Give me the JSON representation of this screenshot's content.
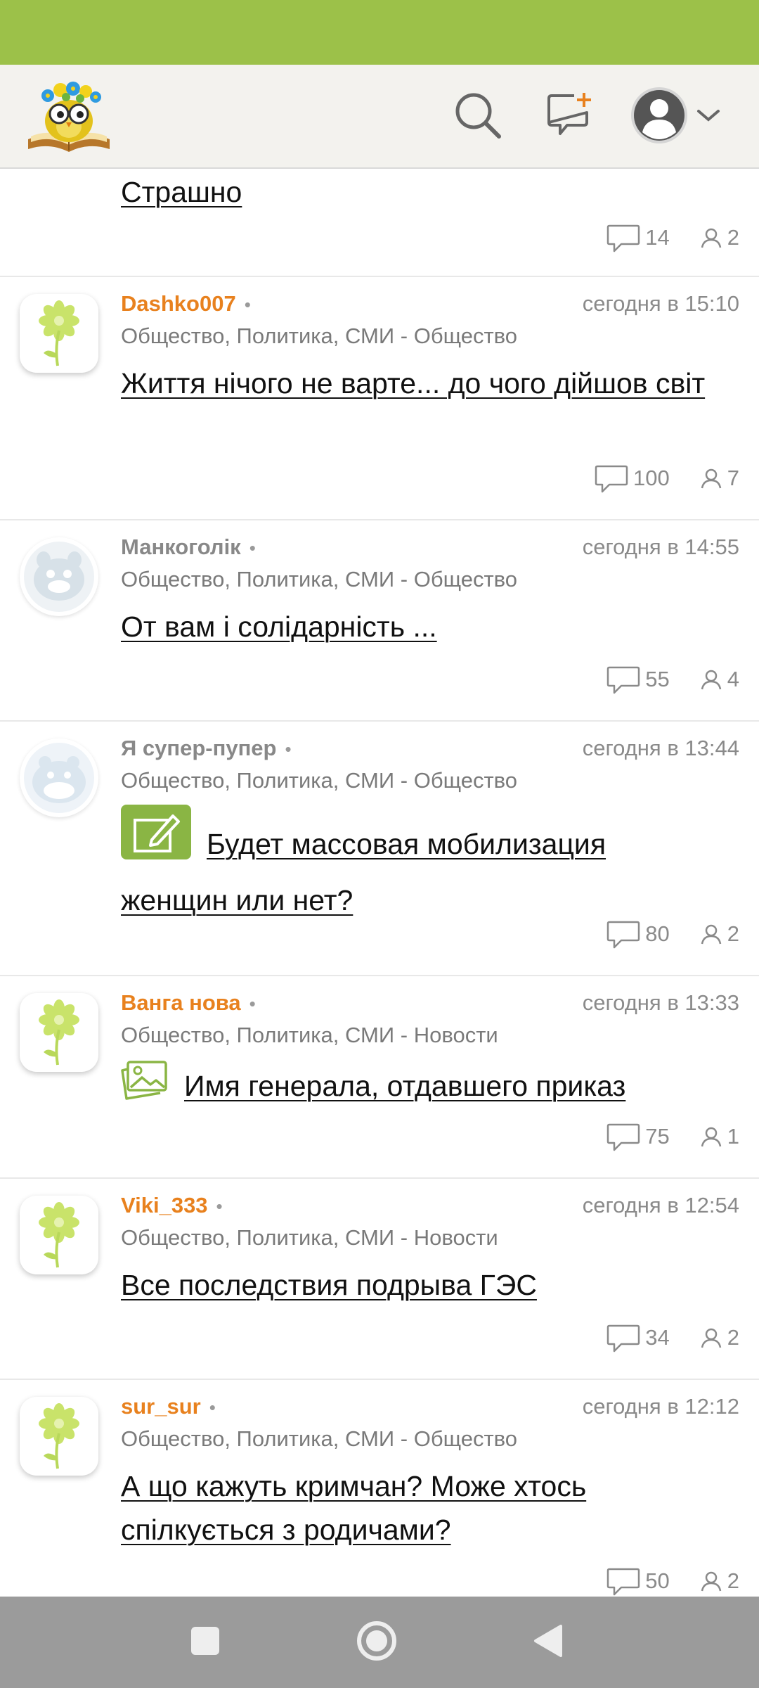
{
  "colors": {
    "status_bar": "#9cc149",
    "accent_author": "#e8811e",
    "muted_text": "#8a8a8a"
  },
  "header": {
    "logo_icon": "owl-with-glasses-on-book-logo",
    "search_icon": "search-icon",
    "new_post_icon": "new-post-icon",
    "profile_icon": "profile-avatar-icon",
    "dropdown_icon": "chevron-down-icon"
  },
  "feed": {
    "top_partial": {
      "title": "Страшно",
      "comments": "14",
      "participants": "2"
    },
    "posts": [
      {
        "author": "Dashko007",
        "time": "сегодня в 15:10",
        "category": "Общество, Политика, СМИ - Общество",
        "title": "Життя нічого не варте... до чого дійшов світ",
        "comments": "100",
        "participants": "7"
      },
      {
        "author": "Манкоголік",
        "time": "сегодня в 14:55",
        "category": "Общество, Политика, СМИ - Общество",
        "title": "От вам і солідарність ...",
        "comments": "55",
        "participants": "4"
      },
      {
        "author": "Я супер-пупер",
        "time": "сегодня в 13:44",
        "category": "Общество, Политика, СМИ - Общество",
        "title": "Будет массовая мобилизация женщин или нет?",
        "title_icon": "poll-icon",
        "comments": "80",
        "participants": "2"
      },
      {
        "author": "Ванга нова",
        "time": "сегодня в 13:33",
        "category": "Общество, Политика, СМИ - Новости",
        "title": "Имя генерала, отдавшего приказ",
        "title_icon": "image-gallery-icon",
        "comments": "75",
        "participants": "1"
      },
      {
        "author": "Viki_333",
        "time": "сегодня в 12:54",
        "category": "Общество, Политика, СМИ - Новости",
        "title": "Все последствия подрыва ГЭС",
        "comments": "34",
        "participants": "2"
      },
      {
        "author": "sur_sur",
        "time": "сегодня в 12:12",
        "category": "Общество, Политика, СМИ - Общество",
        "title": "А що кажуть кримчан? Може хтось спілкується з родичами?",
        "comments": "50",
        "participants": "2"
      }
    ]
  },
  "nav": {
    "recents_icon": "recents-square-icon",
    "home_icon": "home-circle-icon",
    "back_icon": "back-triangle-icon"
  }
}
